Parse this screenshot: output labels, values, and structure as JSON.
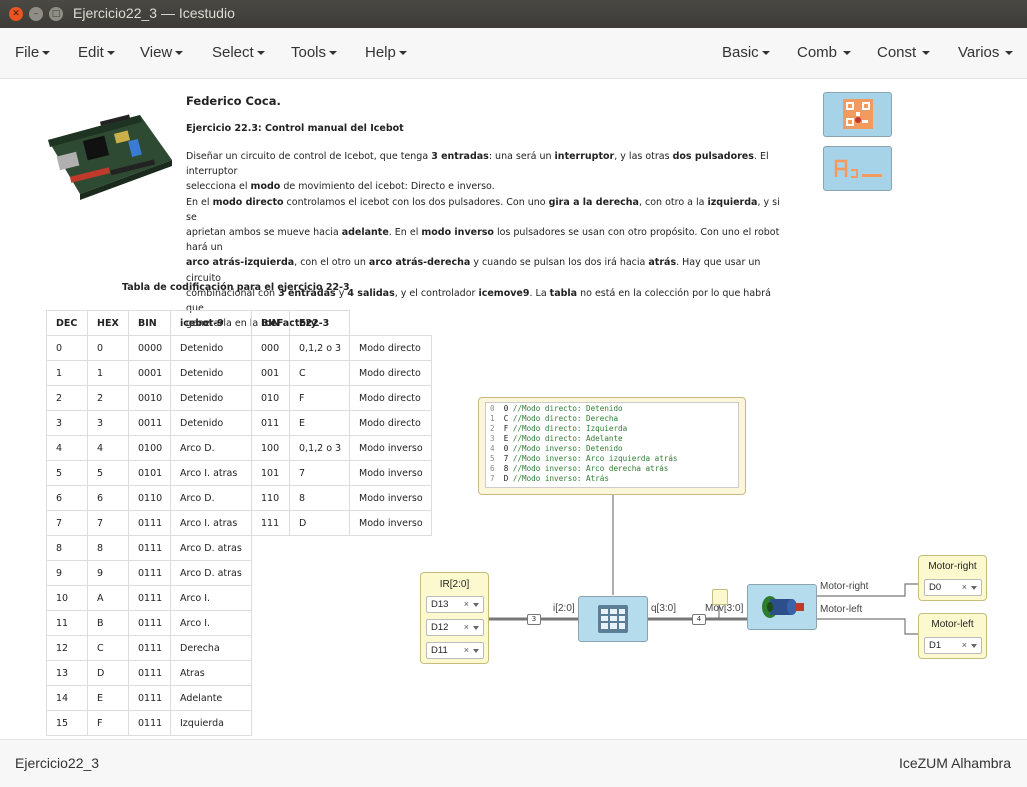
{
  "window": {
    "title": "Ejercicio22_3 — Icestudio"
  },
  "menu": {
    "left": [
      "File",
      "Edit",
      "View",
      "Select",
      "Tools",
      "Help"
    ],
    "right": [
      "Basic",
      "Comb",
      "Const",
      "Varios"
    ]
  },
  "description": {
    "author": "Federico Coca.",
    "subtitle": "Ejercicio 22.3: Control manual del Icebot",
    "body": [
      [
        {
          "t": "Diseñar un circuito de control de Icebot, que tenga "
        },
        {
          "t": "3 entradas",
          "b": true
        },
        {
          "t": ": una será un "
        },
        {
          "t": "interruptor",
          "b": true
        },
        {
          "t": ", y las otras "
        },
        {
          "t": "dos pulsadores",
          "b": true
        },
        {
          "t": ". El interruptor"
        }
      ],
      [
        {
          "t": "selecciona el "
        },
        {
          "t": "modo",
          "b": true
        },
        {
          "t": " de movimiento del icebot: Directo e inverso."
        }
      ],
      [
        {
          "t": "En el "
        },
        {
          "t": "modo directo",
          "b": true
        },
        {
          "t": " controlamos el icebot con los dos pulsadores. Con uno "
        },
        {
          "t": "gira a la derecha",
          "b": true
        },
        {
          "t": ", con otro a la "
        },
        {
          "t": "izquierda",
          "b": true
        },
        {
          "t": ", y si se"
        }
      ],
      [
        {
          "t": "aprietan ambos se mueve hacia "
        },
        {
          "t": "adelante",
          "b": true
        },
        {
          "t": ". En el "
        },
        {
          "t": "modo inverso",
          "b": true
        },
        {
          "t": " los pulsadores se usan con otro propósito. Con uno el robot hará un"
        }
      ],
      [
        {
          "t": "arco atrás-izquierda",
          "b": true
        },
        {
          "t": ", con el otro un "
        },
        {
          "t": "arco atrás-derecha",
          "b": true
        },
        {
          "t": " y cuando se pulsan los dos irá hacia "
        },
        {
          "t": "atrás",
          "b": true
        },
        {
          "t": ". Hay que usar un circuito"
        }
      ],
      [
        {
          "t": "combinacional con "
        },
        {
          "t": "3 entradas",
          "b": true
        },
        {
          "t": " y "
        },
        {
          "t": "4 salidas",
          "b": true
        },
        {
          "t": ", y el controlador "
        },
        {
          "t": "icemove9",
          "b": true
        },
        {
          "t": ". La "
        },
        {
          "t": "tabla",
          "b": true
        },
        {
          "t": " no está en la colección por lo que habrá que"
        }
      ],
      [
        {
          "t": "generarla en la "
        },
        {
          "t": "IceFactory",
          "b": true
        },
        {
          "t": "."
        }
      ]
    ]
  },
  "table": {
    "caption": "Tabla de codificación para el ejercicio 22-3",
    "headers": [
      "DEC",
      "HEX",
      "BIN",
      "icebot-9",
      "BIN",
      "E22-3",
      ""
    ],
    "rows": [
      [
        "0",
        "0",
        "0000",
        "Detenido",
        "000",
        "0,1,2 o 3",
        "Modo directo"
      ],
      [
        "1",
        "1",
        "0001",
        "Detenido",
        "001",
        "C",
        "Modo directo"
      ],
      [
        "2",
        "2",
        "0010",
        "Detenido",
        "010",
        "F",
        "Modo directo"
      ],
      [
        "3",
        "3",
        "0011",
        "Detenido",
        "011",
        "E",
        "Modo directo"
      ],
      [
        "4",
        "4",
        "0100",
        "Arco D.",
        "100",
        "0,1,2 o 3",
        "Modo inverso"
      ],
      [
        "5",
        "5",
        "0101",
        "Arco I. atras",
        "101",
        "7",
        "Modo inverso"
      ],
      [
        "6",
        "6",
        "0110",
        "Arco D.",
        "110",
        "8",
        "Modo inverso"
      ],
      [
        "7",
        "7",
        "0111",
        "Arco I. atras",
        "111",
        "D",
        "Modo inverso"
      ],
      [
        "8",
        "8",
        "0111",
        "Arco D. atras",
        "",
        "",
        ""
      ],
      [
        "9",
        "9",
        "0111",
        "Arco D. atras",
        "",
        "",
        ""
      ],
      [
        "10",
        "A",
        "0111",
        "Arco I.",
        "",
        "",
        ""
      ],
      [
        "11",
        "B",
        "0111",
        "Arco I.",
        "",
        "",
        ""
      ],
      [
        "12",
        "C",
        "0111",
        "Derecha",
        "",
        "",
        ""
      ],
      [
        "13",
        "D",
        "0111",
        "Atras",
        "",
        "",
        ""
      ],
      [
        "14",
        "E",
        "0111",
        "Adelante",
        "",
        "",
        ""
      ],
      [
        "15",
        "F",
        "0111",
        "Izquierda",
        "",
        "",
        ""
      ]
    ]
  },
  "code_block": {
    "lines": [
      [
        "0",
        "0",
        "//Modo directo: Detenido"
      ],
      [
        "1",
        "C",
        "//Modo directo: Derecha"
      ],
      [
        "2",
        "F",
        "//Modo directo: Izquierda"
      ],
      [
        "3",
        "E",
        "//Modo directo: Adelante"
      ],
      [
        "4",
        "0",
        "//Modo inverso: Detenido"
      ],
      [
        "5",
        "7",
        "//Modo inverso: Arco izquierda atrás"
      ],
      [
        "6",
        "8",
        "//Modo inverso: Arco derecha atrás"
      ],
      [
        "7",
        "D",
        "//Modo inverso: Atrás"
      ]
    ]
  },
  "diagram": {
    "input_block": {
      "label": "IR[2:0]",
      "pins": [
        "D13",
        "D12",
        "D11"
      ]
    },
    "table_in_label": "i[2:0]",
    "table_out_label": "q[3:0]",
    "mov_label": "Mov[3:0]",
    "bus_in_width": "3",
    "bus_out_width": "4",
    "motor_right_label": "Motor-right",
    "motor_left_label": "Motor-left",
    "out_right": {
      "label": "Motor-right",
      "pin": "D0"
    },
    "out_left": {
      "label": "Motor-left",
      "pin": "D1"
    },
    "clear_symbol": "×"
  },
  "status": {
    "left": "Ejercicio22_3",
    "right": "IceZUM Alhambra"
  },
  "colors": {
    "module_fill": "#b4dcec",
    "io_fill": "#fdf9cf",
    "wire": "#777777"
  }
}
